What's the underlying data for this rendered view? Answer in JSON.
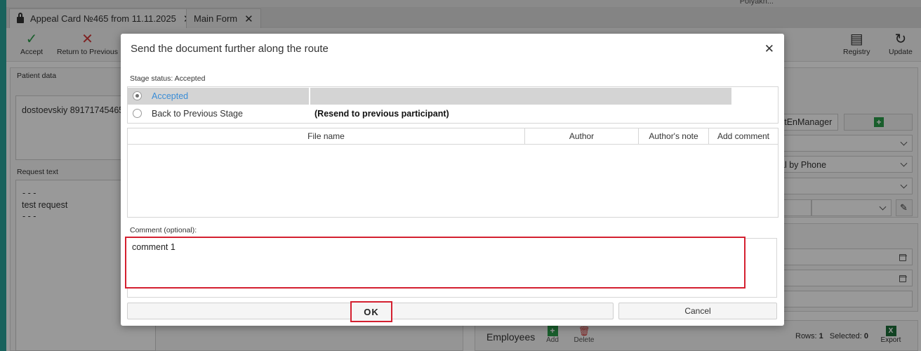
{
  "app": {
    "user_label": "Polyakh...",
    "tabs": [
      {
        "label": "Appeal Card №465 from 11.11.2025",
        "close": "✕"
      },
      {
        "label": "Main Form",
        "close": "✕"
      }
    ],
    "toolbar": {
      "accept": "Accept",
      "return_previous": "Return to Previous",
      "registry": "Registry",
      "update": "Update"
    },
    "patient_data": {
      "label": "Patient data",
      "value": "dostoevskiy 89171745465"
    },
    "request_text": {
      "label": "Request text",
      "lines": [
        "- - -",
        "test request",
        "- - -"
      ]
    },
    "right_form": {
      "manager_value": "stEnManager",
      "channel_value": "al by Phone"
    },
    "employees": {
      "title": "Employees",
      "add": "Add",
      "delete": "Delete",
      "rows_label": "Rows:",
      "rows_value": "1",
      "selected_label": "Selected:",
      "selected_value": "0",
      "export": "Export"
    }
  },
  "dialog": {
    "title": "Send the document further along the route",
    "close_icon": "✕",
    "stage_status": "Stage status: Accepted",
    "options": [
      {
        "label": "Accepted",
        "description": "",
        "selected": true
      },
      {
        "label": "Back to Previous Stage",
        "description": "(Resend to previous participant)",
        "selected": false
      }
    ],
    "grid_columns": [
      "File name",
      "Author",
      "Author's note",
      "Add comment"
    ],
    "comment_label": "Comment (optional):",
    "comment_value": "comment 1",
    "ok_label": "OK",
    "cancel_label": "Cancel",
    "highlight_color": "#d42030",
    "accent_color": "#3b8dd6"
  }
}
